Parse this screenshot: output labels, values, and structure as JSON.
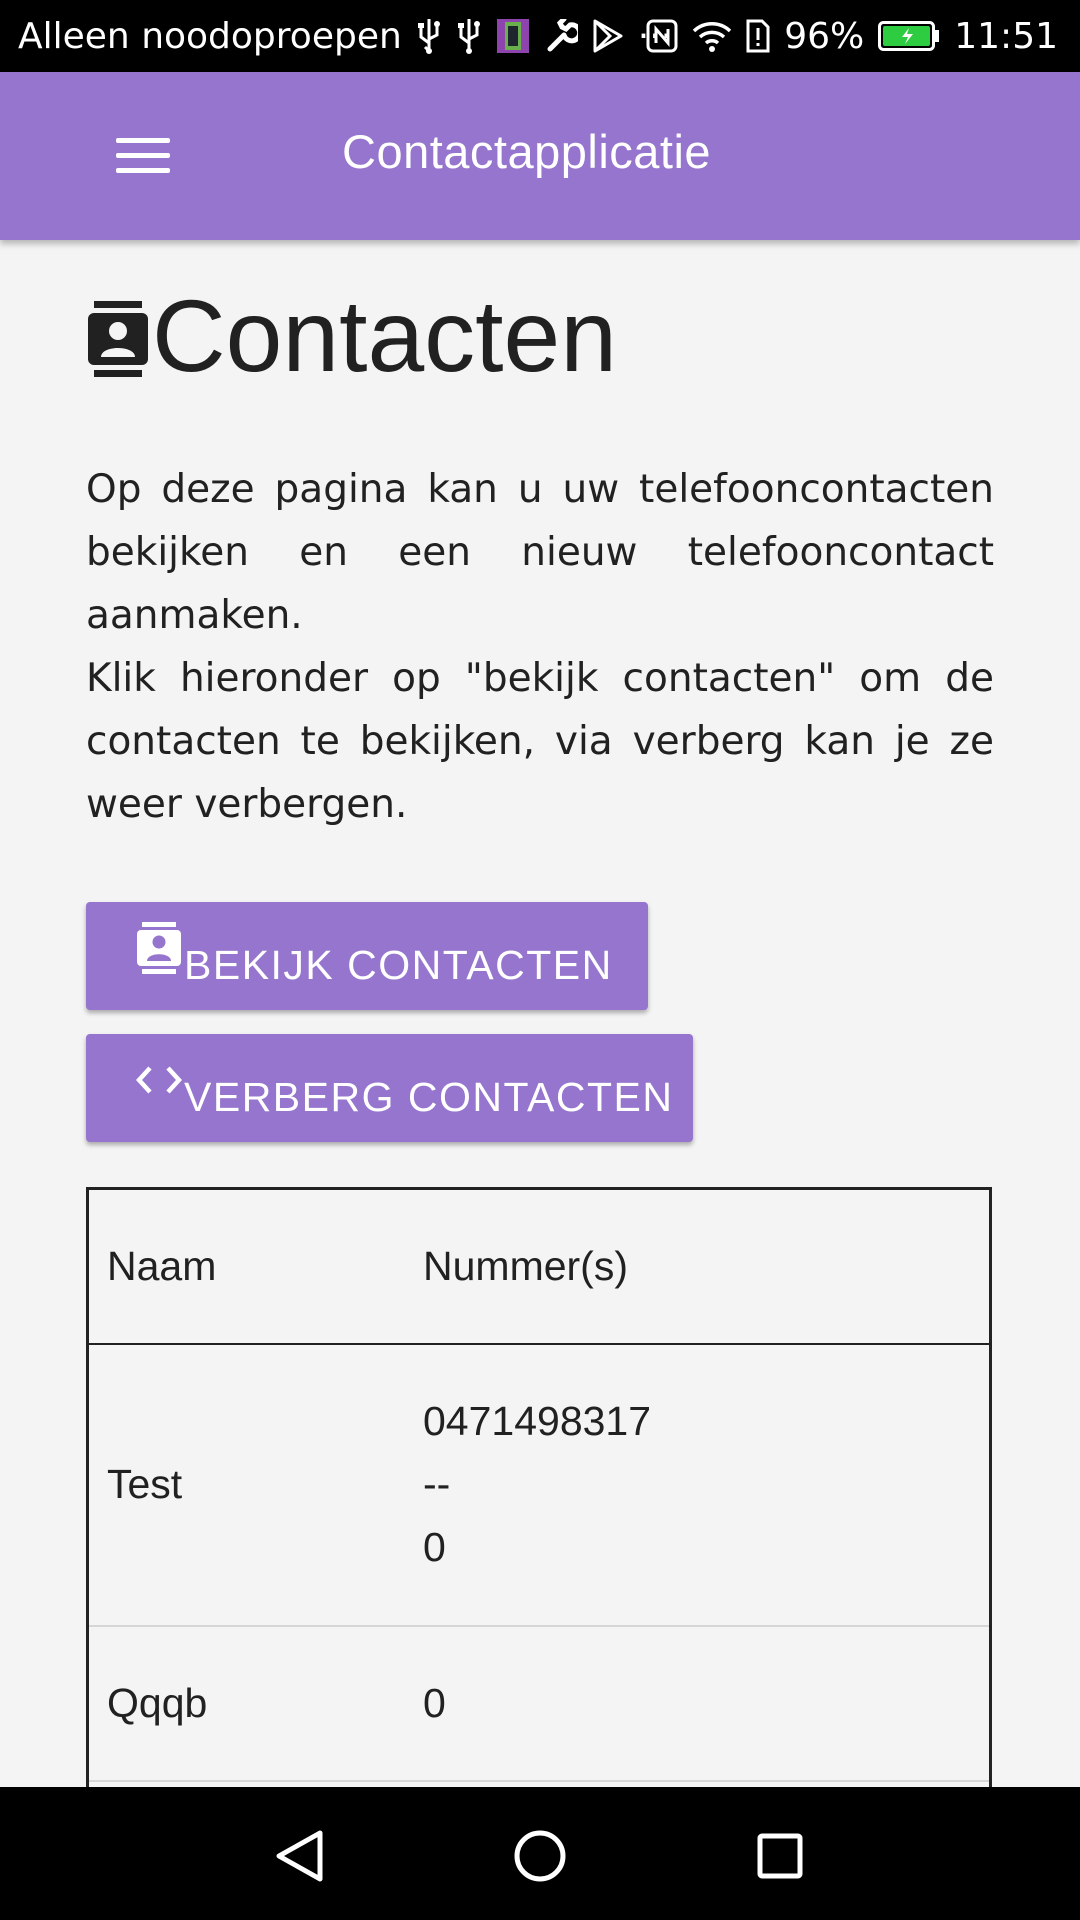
{
  "status_bar": {
    "carrier_text": "Alleen noodoproepen",
    "overflow_text": "···",
    "battery_percent": "96%",
    "time": "11:51",
    "battery_color": "#2ecc40"
  },
  "app_bar": {
    "title": "Contactapplicatie",
    "color": "#9575cd"
  },
  "page": {
    "heading": "Contacten",
    "paragraph1": "Op deze pagina kan u uw telefooncontacten bekijken en een nieuw telefooncontact aanmaken.",
    "paragraph2": "Klik hieronder op \"bekijk contacten\" om de contacten te bekijken, via verberg kan je ze weer verbergen."
  },
  "buttons": {
    "show_label": "BEKIJK CONTACTEN",
    "hide_label": "VERBERG CONTACTEN"
  },
  "table": {
    "headers": [
      "Naam",
      "Nummer(s)"
    ],
    "rows": [
      {
        "name": "Test",
        "numbers": [
          "0471498317",
          "--",
          "0"
        ]
      },
      {
        "name": "Qqqb",
        "numbers": [
          "0"
        ]
      }
    ]
  },
  "icons": {
    "menu": "hamburger-icon",
    "heading": "contacts-icon",
    "show": "contacts-icon",
    "hide": "code-icon",
    "nav_back": "back-triangle-icon",
    "nav_home": "home-circle-icon",
    "nav_recent": "recent-square-icon"
  }
}
